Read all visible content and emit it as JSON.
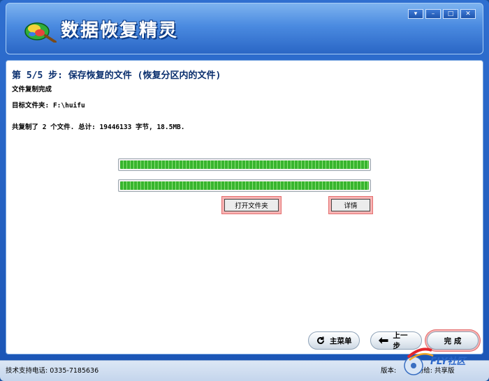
{
  "app": {
    "title": "数据恢复精灵"
  },
  "window_controls": {
    "dropdown": "▾",
    "minimize": "–",
    "maximize": "□",
    "close": "✕"
  },
  "step": {
    "title": "第 5/5 步: 保存恢复的文件 (恢复分区内的文件)",
    "status": "文件复制完成",
    "target": "目标文件夹: F:\\huifu",
    "summary": "共复制了 2 个文件. 总计: 19446133 字节, 18.5MB."
  },
  "progress": {
    "bar1": 100,
    "bar2": 100
  },
  "buttons": {
    "open_folder": "打开文件夹",
    "details": "详情",
    "main_menu": "主菜单",
    "back": "上一步",
    "finish": "完  成"
  },
  "statusbar": {
    "support": "技术支持电话: 0335-7185636",
    "version_label": "版本:",
    "registered_label": "注册给:",
    "registered_value": "共享版"
  },
  "watermark": {
    "brand": "FLY社区"
  },
  "colors": {
    "title_blue": "#0a2f6e",
    "progress_green": "#38b52e",
    "highlight_red": "#e46e6e"
  }
}
